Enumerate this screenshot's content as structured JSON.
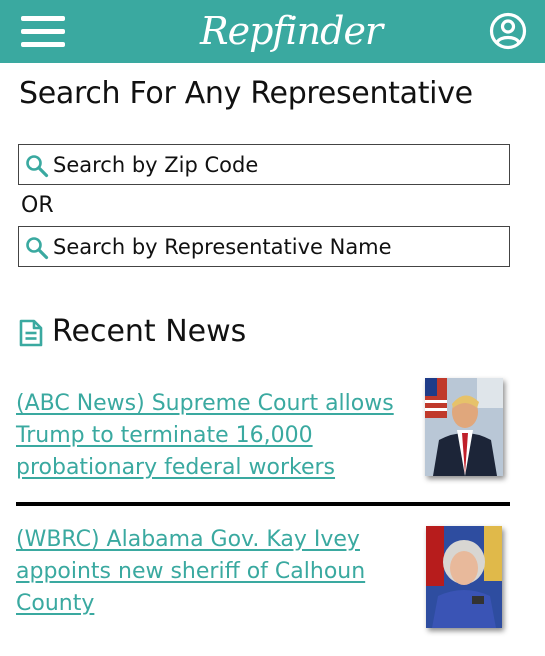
{
  "header": {
    "logo_text": "Repfinder",
    "menu_icon": "hamburger-menu-icon",
    "account_icon": "user-circle-icon",
    "bg_color": "#3aa9a0"
  },
  "search": {
    "title": "Search For Any Representative",
    "zip_placeholder": "Search by Zip Code",
    "or_label": "OR",
    "name_placeholder": "Search by Representative Name"
  },
  "news": {
    "heading": "Recent News",
    "heading_icon": "document-icon",
    "link_color": "#3aa9a0",
    "items": [
      {
        "title": "(ABC News) Supreme Court allows Trump to terminate 16,000 probationary federal workers"
      },
      {
        "title": "(WBRC) Alabama Gov. Kay Ivey appoints new sheriff of Calhoun County"
      }
    ]
  }
}
